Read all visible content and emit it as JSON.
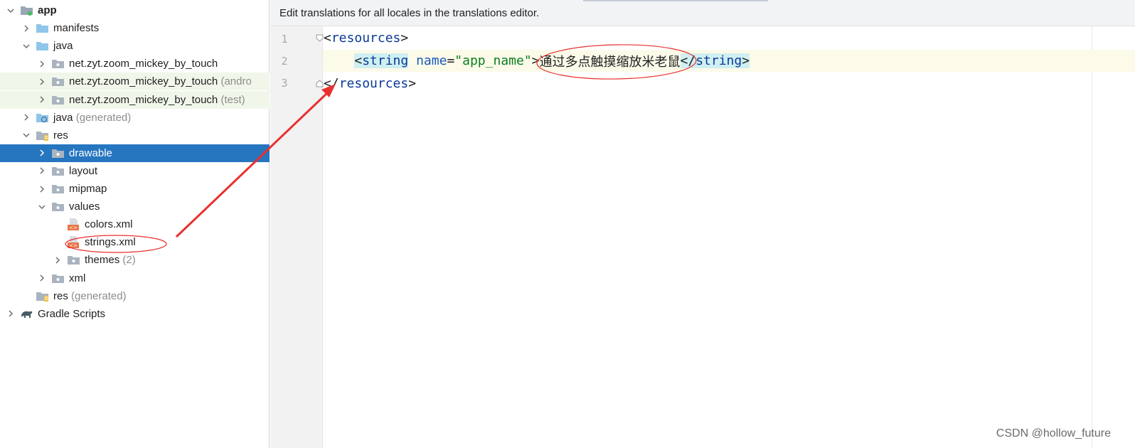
{
  "tree": [
    {
      "label": "app",
      "bold": true,
      "depth": 0,
      "expanded": true,
      "icon": "module-folder-icon"
    },
    {
      "label": "manifests",
      "depth": 1,
      "expanded": false,
      "icon": "folder-icon"
    },
    {
      "label": "java",
      "depth": 1,
      "expanded": true,
      "icon": "folder-icon"
    },
    {
      "label": "net.zyt.zoom_mickey_by_touch",
      "depth": 2,
      "expanded": false,
      "icon": "package-icon"
    },
    {
      "label": "net.zyt.zoom_mickey_by_touch",
      "suffix": "(andro",
      "depth": 2,
      "expanded": false,
      "icon": "package-icon",
      "tinted": true
    },
    {
      "label": "net.zyt.zoom_mickey_by_touch",
      "suffix": "(test)",
      "depth": 2,
      "expanded": false,
      "icon": "package-icon",
      "tinted": true
    },
    {
      "label": "java",
      "suffix": "(generated)",
      "depth": 1,
      "expanded": false,
      "icon": "generated-folder-icon"
    },
    {
      "label": "res",
      "depth": 1,
      "expanded": true,
      "icon": "resource-folder-icon"
    },
    {
      "label": "drawable",
      "depth": 2,
      "expanded": false,
      "icon": "package-icon",
      "selected": true
    },
    {
      "label": "layout",
      "depth": 2,
      "expanded": false,
      "icon": "package-icon"
    },
    {
      "label": "mipmap",
      "depth": 2,
      "expanded": false,
      "icon": "package-icon"
    },
    {
      "label": "values",
      "depth": 2,
      "expanded": true,
      "icon": "package-icon"
    },
    {
      "label": "colors.xml",
      "depth": 3,
      "leaf": true,
      "icon": "xml-file-icon"
    },
    {
      "label": "strings.xml",
      "depth": 3,
      "leaf": true,
      "icon": "xml-file-icon"
    },
    {
      "label": "themes",
      "suffix": "(2)",
      "depth": 3,
      "expanded": false,
      "icon": "package-icon"
    },
    {
      "label": "xml",
      "depth": 2,
      "expanded": false,
      "icon": "package-icon"
    },
    {
      "label": "res",
      "suffix": "(generated)",
      "depth": 1,
      "leaf": true,
      "icon": "resource-folder-icon"
    },
    {
      "label": "Gradle Scripts",
      "depth": 0,
      "expanded": false,
      "icon": "gradle-icon"
    }
  ],
  "editor": {
    "banner": "Edit translations for all locales in the translations editor.",
    "line_numbers": [
      "1",
      "2",
      "3"
    ],
    "line1": {
      "open": "<",
      "tag": "resources",
      "close": ">"
    },
    "line2": {
      "indent": "    ",
      "open": "<",
      "tag": "string",
      "space": " ",
      "attr": "name",
      "eq": "=",
      "value": "\"app_name\"",
      "gt": ">",
      "text": "通过多点触摸缩放米老鼠",
      "end_open": "</",
      "end_tag": "string",
      "end_close": ">"
    },
    "line3": {
      "open": "</",
      "tag": "resources",
      "close": ">"
    }
  },
  "watermark": "CSDN @hollow_future",
  "colors": {
    "selection": "#2675bf",
    "annotation": "#e8302f",
    "tag": "#0a3a96",
    "value": "#0a7f1f"
  }
}
